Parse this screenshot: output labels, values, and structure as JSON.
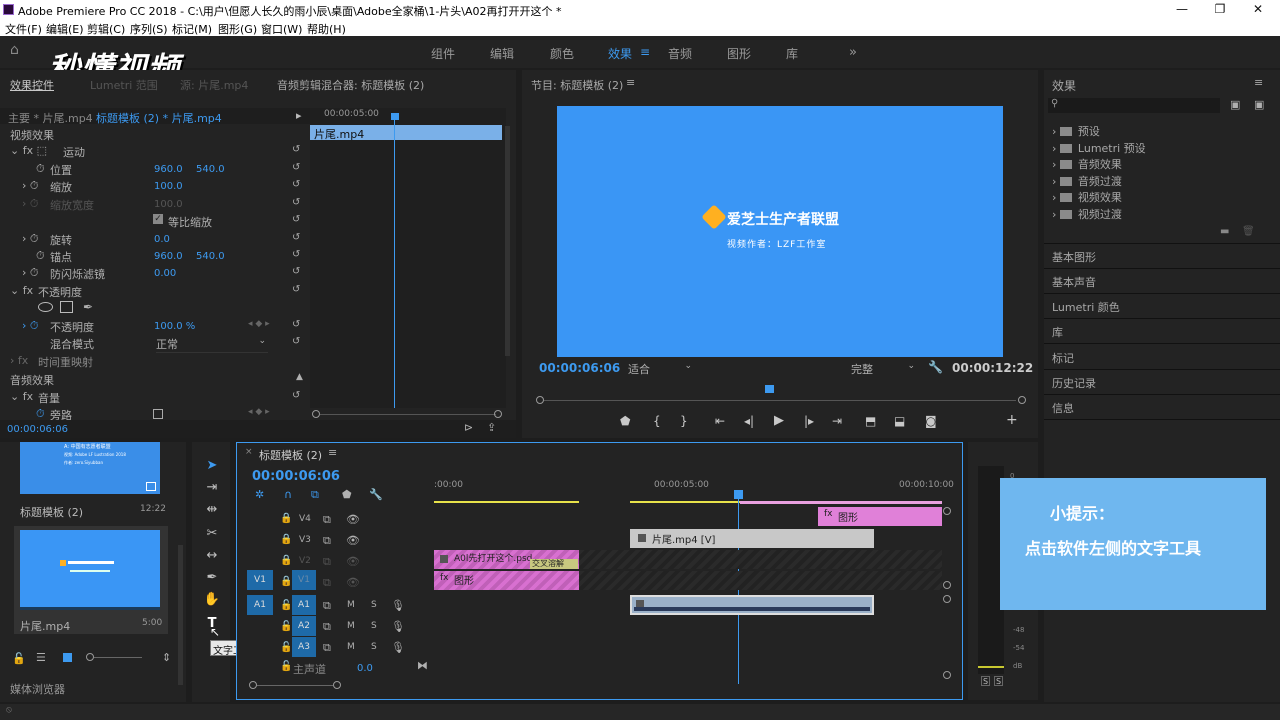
{
  "app": {
    "title": "Adobe Premiere Pro CC 2018 - C:\\用户\\但愿人长久的雨小辰\\桌面\\Adobe全家桶\\1-片头\\A02再打开开这个 *",
    "menu": [
      "文件(F)",
      "编辑(E)",
      "剪辑(C)",
      "序列(S)",
      "标记(M)",
      "图形(G)",
      "窗口(W)",
      "帮助(H)"
    ]
  },
  "workspaces": {
    "items": [
      "组件",
      "编辑",
      "颜色",
      "效果",
      "音频",
      "图形",
      "库"
    ],
    "active": "效果",
    "more": "»"
  },
  "watermark": "秒懂视频",
  "effect_controls": {
    "tabs": [
      "效果控件",
      "Lumetri 范围",
      "源: 片尾.mp4",
      "音频剪辑混合器: 标题模板 (2)"
    ],
    "master": "主要 * 片尾.mp4",
    "sequence": "标题模板 (2) * 片尾.mp4",
    "timecode_top": "00:00:05:00",
    "clip_label": "片尾.mp4",
    "video_effects": "视频效果",
    "motion": "运动",
    "position_label": "位置",
    "position_x": "960.0",
    "position_y": "540.0",
    "scale_label": "缩放",
    "scale": "100.0",
    "scale_width_label": "缩放宽度",
    "scale_width": "100.0",
    "uniform_scale": "等比缩放",
    "rotation_label": "旋转",
    "rotation": "0.0",
    "anchor_label": "锚点",
    "anchor_x": "960.0",
    "anchor_y": "540.0",
    "flicker_label": "防闪烁滤镜",
    "flicker": "0.00",
    "opacity_section": "不透明度",
    "opacity_label": "不透明度",
    "opacity": "100.0 %",
    "blend_label": "混合模式",
    "blend": "正常",
    "time_remap": "时间重映射",
    "audio_effects": "音频效果",
    "volume": "音量",
    "bypass": "旁路",
    "timecode_bottom": "00:00:06:06"
  },
  "program": {
    "title": "节目: 标题模板 (2)",
    "logo_text": "爱芝士生产者联盟",
    "sub_text": "视频作者：LZF工作室",
    "timecode": "00:00:06:06",
    "fit": "适合",
    "quality": "完整",
    "duration": "00:00:12:22",
    "bg_color": "#3a96f5"
  },
  "effects_panel": {
    "title": "效果",
    "folders": [
      "预设",
      "Lumetri 预设",
      "音频效果",
      "音频过渡",
      "视频效果",
      "视频过渡"
    ],
    "sections": [
      "基本图形",
      "基本声音",
      "Lumetri 颜色",
      "库",
      "标记",
      "历史记录",
      "信息"
    ]
  },
  "project": {
    "item1_name": "标题模板 (2)",
    "item1_duration": "12:22",
    "item1_lines": [
      "A: 中国有志愿者联盟",
      "视频: Adobe LF Lustration 2018",
      "作者: zero.Siyubban"
    ],
    "item2_name": "片尾.mp4",
    "item2_duration": "5:00",
    "media_browser": "媒体浏览器"
  },
  "tools": {
    "tooltip": "文字工具 (T)"
  },
  "timeline": {
    "title": "标题模板 (2)",
    "timecode": "00:00:06:06",
    "ruler": [
      ":00:00",
      "00:00:05:00",
      "00:00:10:00"
    ],
    "tracks_video": [
      "V4",
      "V3",
      "V2",
      "V1"
    ],
    "tracks_audio": [
      "A1",
      "A2",
      "A3"
    ],
    "master": "主声道",
    "master_val": "0.0",
    "clip_v4": "图形",
    "clip_v3": "片尾.mp4 [V]",
    "clip_v2": "A0l先打开这个.psd",
    "clip_v2_trans": "交叉溶解",
    "clip_v1": "图形",
    "ms": [
      "M",
      "S"
    ]
  },
  "audio_meter": {
    "db_labels": [
      "0",
      "-48",
      "-54",
      "dB"
    ],
    "solo": [
      "S",
      "S"
    ]
  },
  "tip": {
    "title": "小提示：",
    "body": "点击软件左侧的文字工具",
    "bg": "#6fb7ef"
  }
}
